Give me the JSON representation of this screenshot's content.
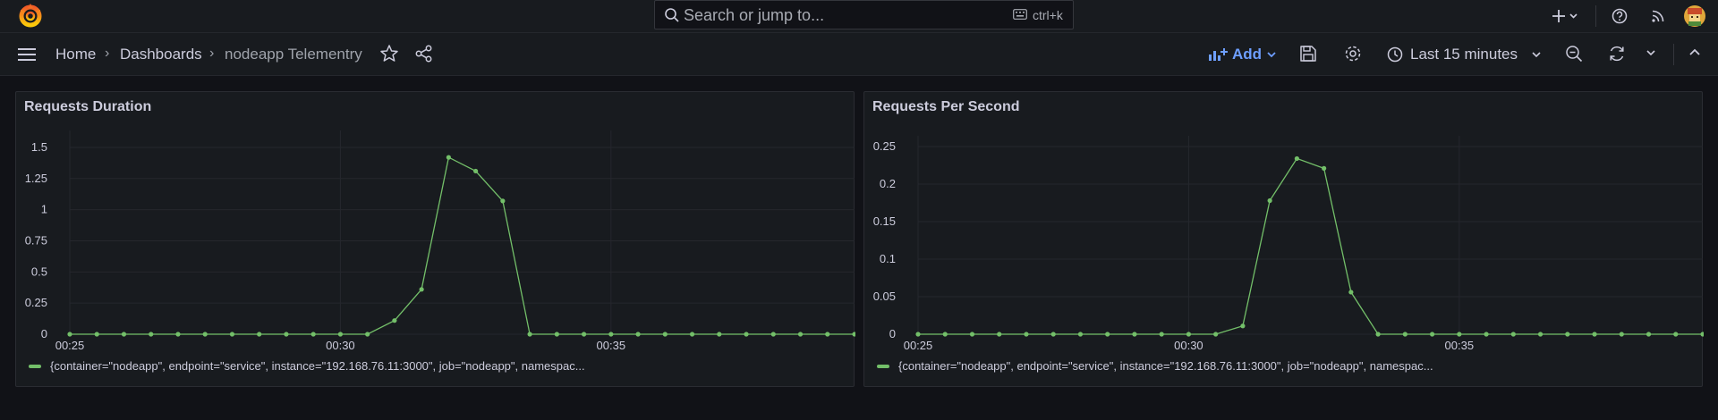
{
  "topbar": {
    "search_placeholder": "Search or jump to...",
    "search_shortcut": "ctrl+k",
    "icons": [
      "grafana-logo-icon",
      "search-icon",
      "keyboard-icon",
      "plus-icon",
      "help-icon",
      "rss-icon",
      "avatar"
    ]
  },
  "navbar": {
    "breadcrumbs": [
      "Home",
      "Dashboards",
      "nodeapp Telementry"
    ],
    "add_label": "Add",
    "time_range": "Last 15 minutes"
  },
  "colors": {
    "accent": "#6e9fff",
    "series": "#73bf69",
    "panel_bg": "#181b1f",
    "page_bg": "#111217"
  },
  "panels": [
    {
      "title": "Requests Duration",
      "legend": "{container=\"nodeapp\", endpoint=\"service\", instance=\"192.168.76.11:3000\", job=\"nodeapp\", namespac..."
    },
    {
      "title": "Requests Per Second",
      "legend": "{container=\"nodeapp\", endpoint=\"service\", instance=\"192.168.76.11:3000\", job=\"nodeapp\", namespac..."
    }
  ],
  "chart_data": [
    {
      "type": "line",
      "title": "Requests Duration",
      "x_tick_labels": [
        "00:25",
        "00:30",
        "00:35"
      ],
      "x_ticks_at_index": [
        0,
        10,
        20
      ],
      "y_ticks": [
        0,
        0.25,
        0.5,
        0.75,
        1,
        1.25,
        1.5
      ],
      "y_tick_labels": [
        "0",
        "0.25",
        "0.5",
        "0.75",
        "1",
        "1.25",
        "1.5"
      ],
      "ylim": [
        0,
        1.55
      ],
      "grid": true,
      "legend_position": "bottom-left",
      "series": [
        {
          "values": [
            0,
            0,
            0,
            0,
            0,
            0,
            0,
            0,
            0,
            0,
            0,
            0,
            0.11,
            0.36,
            1.42,
            1.31,
            1.07,
            0,
            0,
            0,
            0,
            0,
            0,
            0,
            0,
            0,
            0,
            0,
            0,
            0
          ]
        }
      ]
    },
    {
      "type": "line",
      "title": "Requests Per Second",
      "x_tick_labels": [
        "00:25",
        "00:30",
        "00:35"
      ],
      "x_ticks_at_index": [
        0,
        10,
        20
      ],
      "y_ticks": [
        0,
        0.05,
        0.1,
        0.15,
        0.2,
        0.25
      ],
      "y_tick_labels": [
        "0",
        "0.05",
        "0.1",
        "0.15",
        "0.2",
        "0.25"
      ],
      "ylim": [
        0,
        0.25
      ],
      "grid": true,
      "legend_position": "bottom-left",
      "series": [
        {
          "values": [
            0,
            0,
            0,
            0,
            0,
            0,
            0,
            0,
            0,
            0,
            0,
            0,
            0.011,
            0.178,
            0.234,
            0.221,
            0.056,
            0,
            0,
            0,
            0,
            0,
            0,
            0,
            0,
            0,
            0,
            0,
            0,
            0
          ]
        }
      ]
    }
  ]
}
